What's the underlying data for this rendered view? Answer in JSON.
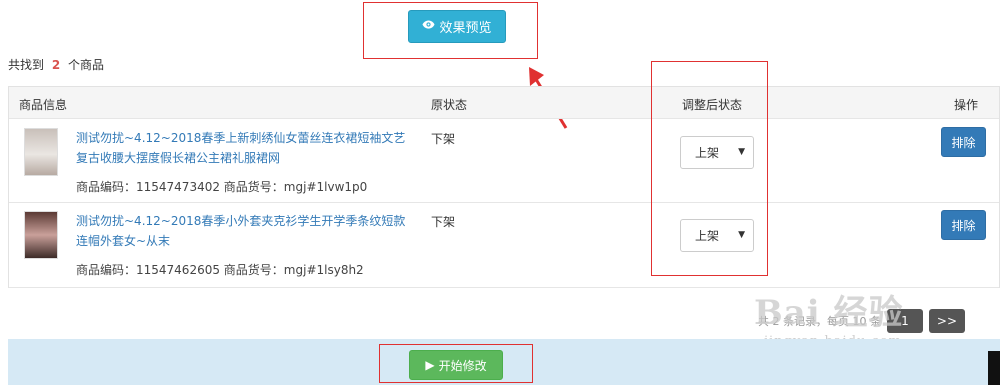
{
  "preview_button": {
    "label": "效果预览",
    "icon": "eye-icon"
  },
  "found": {
    "prefix": "共找到",
    "count": "2",
    "suffix": "个商品"
  },
  "table": {
    "headers": {
      "info": "商品信息",
      "original": "原状态",
      "adjusted": "调整后状态",
      "action": "操作"
    },
    "rows": [
      {
        "title": "测试勿扰~4.12~2018春季上新刺绣仙女蕾丝连衣裙短袖文艺复古收腰大摆度假长裙公主裙礼服裙网",
        "codes": "商品编码：11547473402 商品货号：mgj#1lvw1p0",
        "original_status": "下架",
        "adjusted_status": "上架",
        "action": "排除"
      },
      {
        "title": "测试勿扰~4.12~2018春季小外套夹克衫学生开学季条纹短款连帽外套女~从末",
        "codes": "商品编码：11547462605 商品货号：mgj#1lsy8h2",
        "original_status": "下架",
        "adjusted_status": "上架",
        "action": "排除"
      }
    ]
  },
  "pagination": {
    "summary": "共 2 条记录，每页 10 条",
    "current": "1",
    "next": ">>"
  },
  "start_button": {
    "label": "开始修改",
    "icon": "play-icon"
  },
  "watermark": {
    "main": "Bai 经验",
    "sub": "jingyan.baidu.com"
  },
  "colors": {
    "annotation_red": "#e03131",
    "preview_button": "#31b0d5",
    "start_button": "#5cb85c",
    "exclude_button": "#337ab7",
    "footer_bg": "#d6e9f5"
  }
}
